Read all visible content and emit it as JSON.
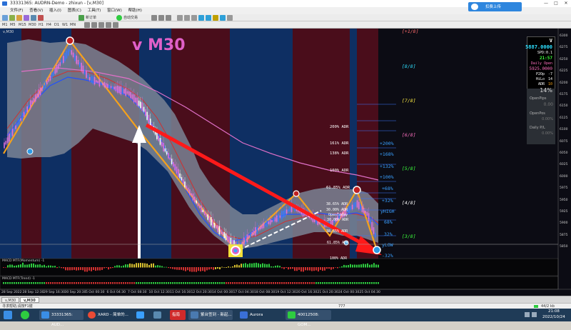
{
  "window": {
    "title": "33331365: AUDRN-Demo - zhixun - [v,M30]"
  },
  "menu": [
    "文件(F)",
    "查看(V)",
    "插入(I)",
    "图表(C)",
    "工具(T)",
    "窗口(W)",
    "帮助(H)"
  ],
  "toolbar": {
    "new_order_label": "新订单",
    "auto_trade_label": "自动交易",
    "timeframes": [
      "M1",
      "M5",
      "M15",
      "M30",
      "H1",
      "H4",
      "D1",
      "W1",
      "MN"
    ]
  },
  "cloud_button": "扣费上传",
  "chart": {
    "symbol_tab": "v,M30",
    "big_title": "v M30",
    "murrey_levels": [
      "[+1/8]",
      "[8/8]",
      "[7/8]",
      "[6/8]",
      "[5/8]",
      "[4/8]",
      "[3/8]"
    ],
    "adr_labels": [
      "200% ADR",
      "161% ADR",
      "138% ADR",
      "100% ADR",
      "61.85% ADR",
      "38.65% ADR",
      "30.00% ADR",
      "38.65% ADR",
      "61.85% ADR",
      "100% ADR"
    ],
    "fibo_labels": [
      "OpenToday",
      "30.00% ADR"
    ],
    "pct_labels": [
      "+200%",
      "+168%",
      "+132%",
      "+100%",
      "+68%",
      "+32%",
      "yHIGH",
      "68%",
      "32%",
      "yLOW",
      "-32%"
    ],
    "indicator1_label": "MACD MTF(Momentum) -1",
    "indicator2_label": "MACD MTF(Trend) -1",
    "x_labels": [
      "28 Sep 2022",
      "28 Sep 12:30",
      "29 Sep 16:30",
      "30 Sep 20:30",
      "5 Oct 00:30",
      "6 Oct 04:30",
      "7 Oct 08:30",
      "10 Oct 12:30",
      "11 Oct 16:30",
      "12 Oct 20:30",
      "14 Oct 00:30",
      "17 Oct 04:30",
      "18 Oct 08:30",
      "19 Oct 12:30",
      "20 Oct 16:30",
      "21 Oct 20:30",
      "24 Oct 00:30",
      "25 Oct 04:30"
    ],
    "y_labels": [
      "6300",
      "6275",
      "6250",
      "6225",
      "6200",
      "6175",
      "6150",
      "6125",
      "6100",
      "6075",
      "6050",
      "6025",
      "6000",
      "5975",
      "5950",
      "5925",
      "5900",
      "5875",
      "5850"
    ]
  },
  "info_panel": {
    "letter": "V",
    "price": "5887.0000",
    "spd": "SPD:0.1",
    "time": "21:57",
    "daily_open_label": "Daily Open",
    "daily_open_value": "5925.0000",
    "p2op_label": "P2Op",
    "p2op_value": "-7",
    "hilo_label": "HiLo",
    "hilo_value": "14",
    "adr_label": "ADR",
    "adr_value": "10",
    "pct": "14%",
    "open_pips_label": "OpenPips",
    "open_pips_value": "0.00",
    "open_pos_label": "OpenPos",
    "open_pos_value": "0.00%",
    "daily_pl_label": "Daily P/L",
    "daily_pl_value": "0.00%"
  },
  "tabs": [
    "v,M30",
    "v,M30"
  ],
  "status": {
    "help_text": "寻求帮助,请按F1键",
    "middle": "777",
    "right": "44/2 kb"
  },
  "taskbar": {
    "apps": [
      "33331365: AUD...",
      "XARD - 简单的...",
      "",
      "",
      "指南",
      "",
      "紫台签到 - 新起...",
      "Aurora",
      "40012508: GOM..."
    ],
    "time": "21:08",
    "date": "2022/10/24"
  },
  "colors": {
    "chart_bg": "#0c0c14",
    "band_red": "#4a0d1b",
    "band_blue": "#0e2f63",
    "cloud": "#7a8494",
    "arrow_red": "#ff1a1a",
    "orange": "#f6a21a",
    "pink_ma": "#e070c8",
    "murrey_cyan": "#2ee0ff",
    "murrey_yellow": "#ffee44",
    "murrey_green": "#3cff3c",
    "murrey_pink": "#ff70c0"
  }
}
